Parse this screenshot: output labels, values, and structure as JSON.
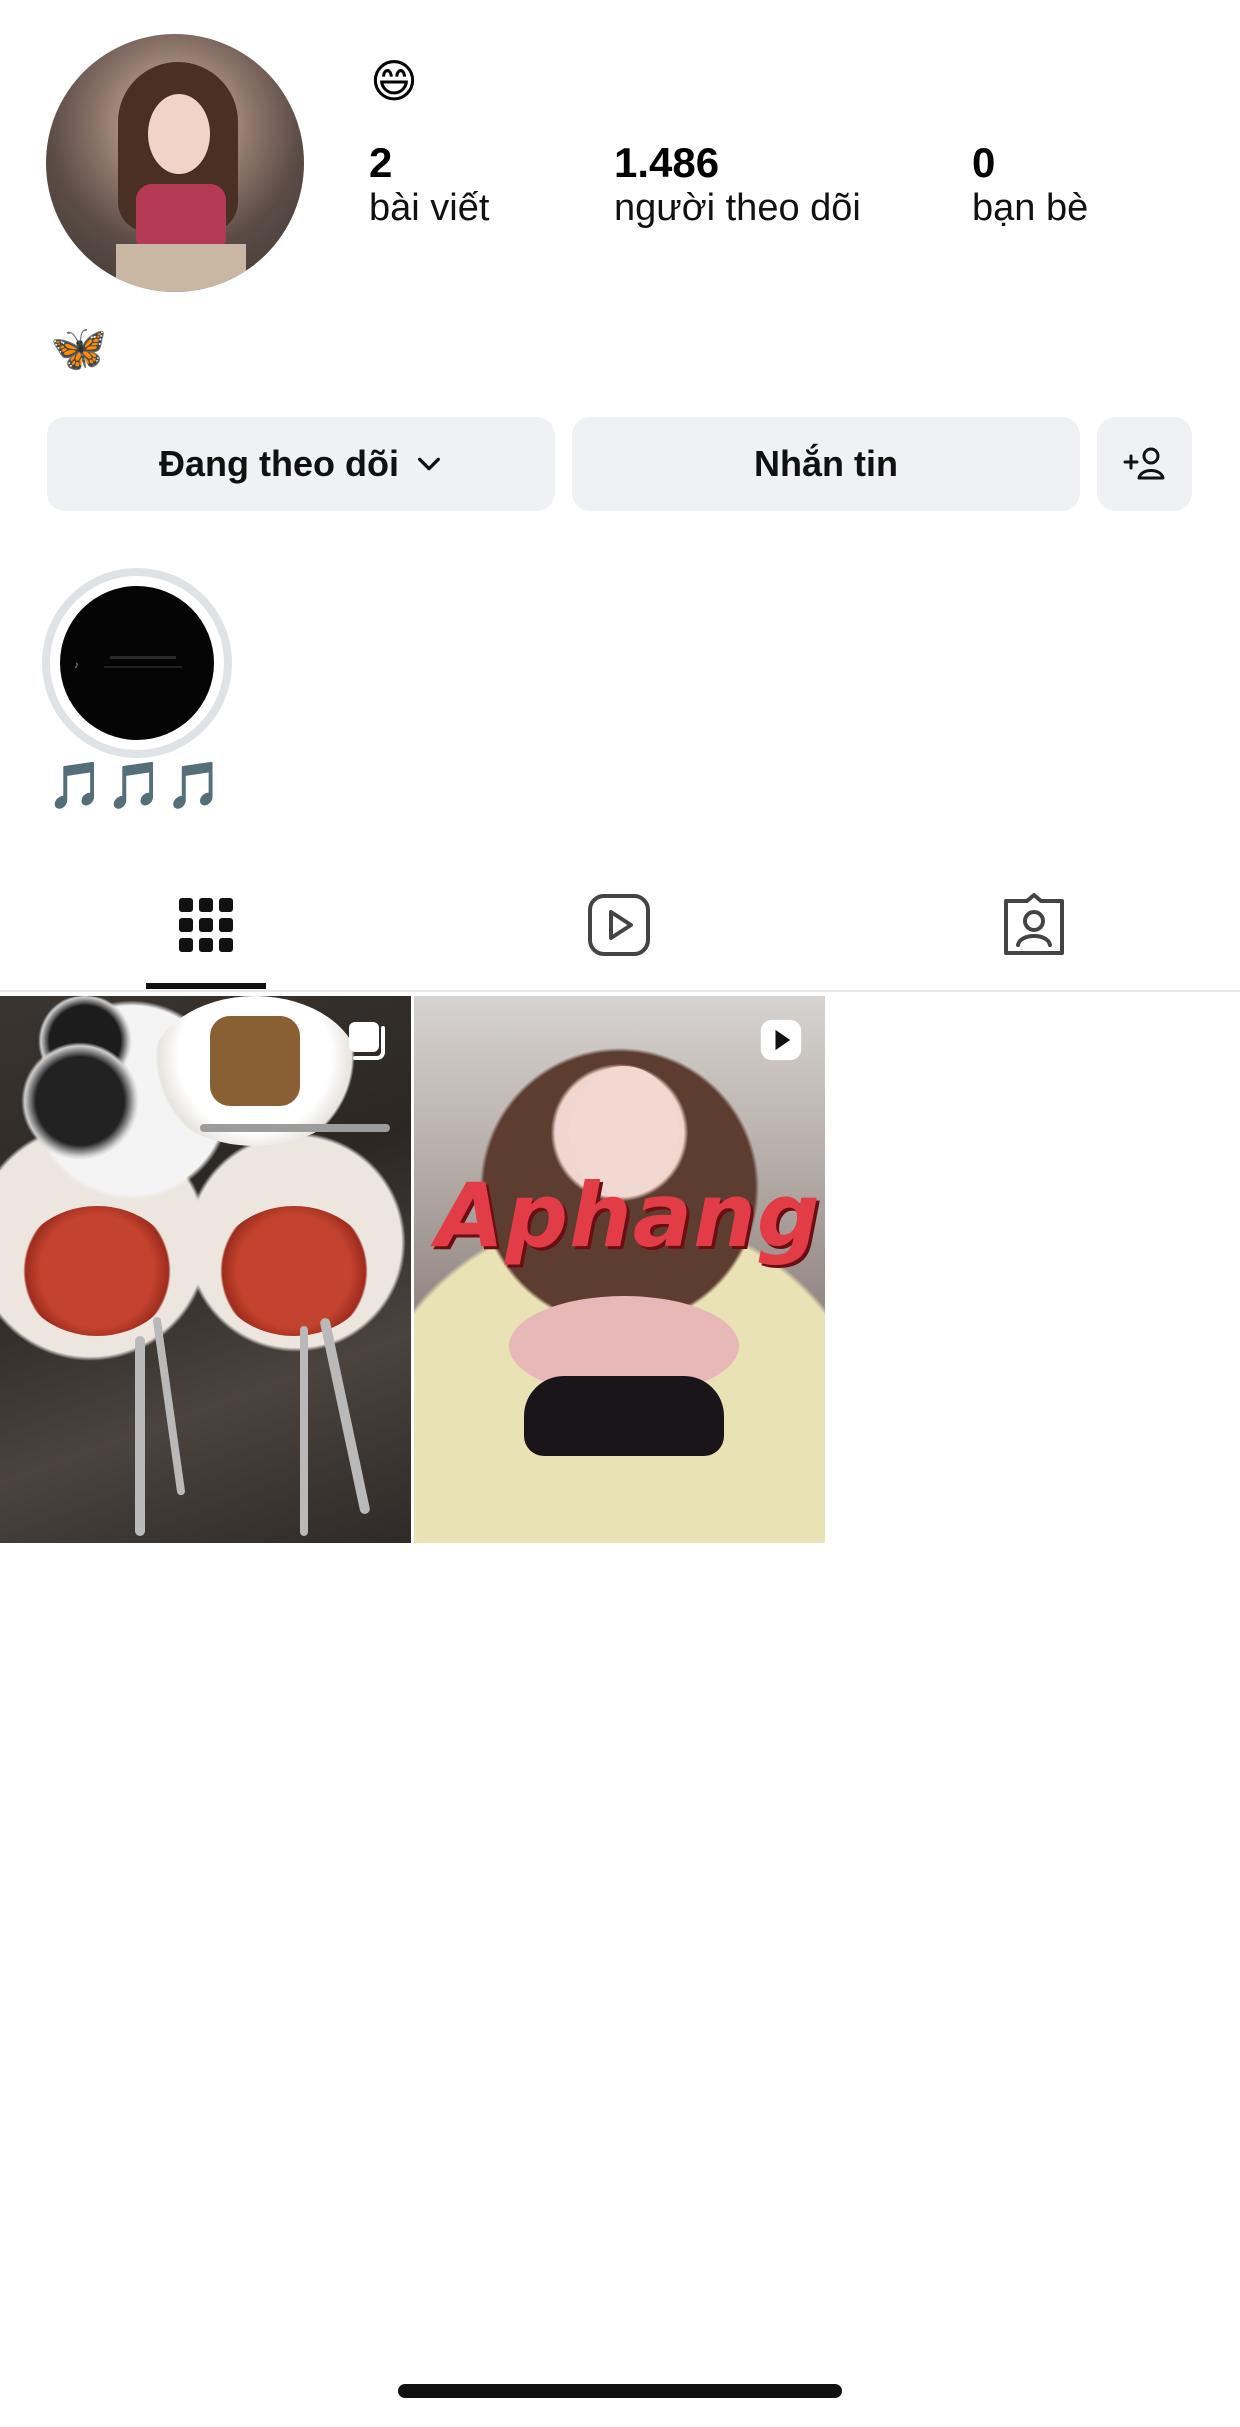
{
  "profile": {
    "status_emoji": "😄",
    "bio_emoji": "🦋",
    "stats": {
      "posts": {
        "value": "2",
        "label": "bài viết"
      },
      "followers": {
        "value": "1.486",
        "label": "người theo dõi"
      },
      "friends": {
        "value": "0",
        "label": "bạn bè"
      }
    }
  },
  "actions": {
    "following_label": "Đang theo dõi",
    "message_label": "Nhắn tin",
    "add_user_icon": "add-user-icon"
  },
  "highlights": [
    {
      "label": "🎵🎵🎵"
    }
  ],
  "tabs": [
    {
      "name": "grid",
      "icon": "grid-icon",
      "active": true
    },
    {
      "name": "reels",
      "icon": "reels-icon",
      "active": false
    },
    {
      "name": "tagged",
      "icon": "tagged-icon",
      "active": false
    }
  ],
  "posts": [
    {
      "type": "carousel",
      "badge_icon": "multiple-posts-icon"
    },
    {
      "type": "video",
      "badge_icon": "play-icon",
      "overlay_text": "Aphang"
    }
  ],
  "colors": {
    "button_bg": "#eff1f4",
    "highlight_ring": "#dfe2e6",
    "active_tab": "#111111"
  }
}
